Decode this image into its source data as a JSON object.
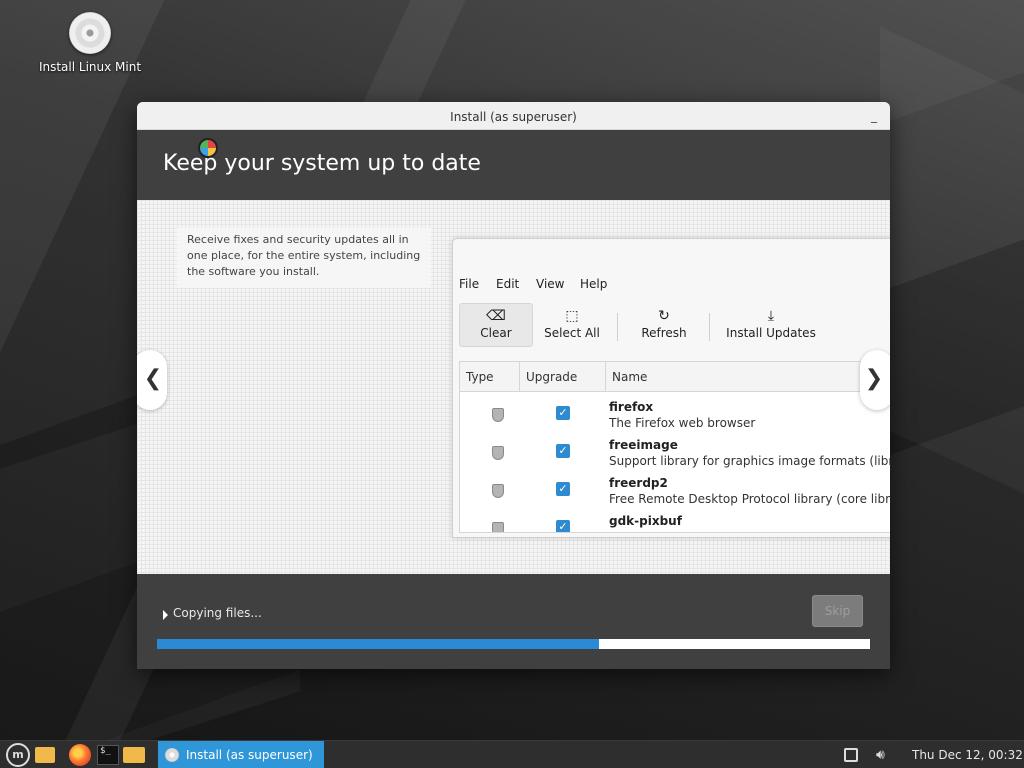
{
  "desktop": {
    "icons": [
      {
        "label": "Install Linux Mint",
        "icon": "disc-icon"
      }
    ]
  },
  "window": {
    "title": "Install (as superuser)",
    "minimize_label": "_",
    "header_title": "Keep your system up to date",
    "slide": {
      "description": "Receive fixes and security updates all in one place, for the entire system, including the software you install.",
      "prev_arrow": "❮",
      "next_arrow": "❯",
      "mock_app": {
        "menu": [
          "File",
          "Edit",
          "View",
          "Help"
        ],
        "toolbar": [
          {
            "label": "Clear",
            "icon": "backspace-icon"
          },
          {
            "label": "Select All",
            "icon": "select-all-icon"
          },
          {
            "label": "Refresh",
            "icon": "refresh-icon"
          },
          {
            "label": "Install Updates",
            "icon": "download-icon"
          }
        ],
        "columns": [
          "Type",
          "Upgrade",
          "Name"
        ],
        "rows": [
          {
            "name": "firefox",
            "description": "The Firefox web browser",
            "checked": true
          },
          {
            "name": "freeimage",
            "description": "Support library for graphics image formats (libr",
            "checked": true
          },
          {
            "name": "freerdp2",
            "description": "Free Remote Desktop Protocol library (core libr",
            "checked": true
          },
          {
            "name": "gdk-pixbuf",
            "description": "",
            "checked": true
          }
        ]
      }
    },
    "progress": {
      "label": "Copying files...",
      "skip_label": "Skip",
      "fraction": 0.62,
      "fill_color": "#2a8ad4"
    }
  },
  "taskbar": {
    "active_task": "Install (as superuser)",
    "clock": "Thu Dec 12, 00:32",
    "launchers": [
      "menu-icon",
      "files-icon",
      "firefox-icon",
      "terminal-icon",
      "folder-icon"
    ],
    "accent": "#2f96d8"
  }
}
